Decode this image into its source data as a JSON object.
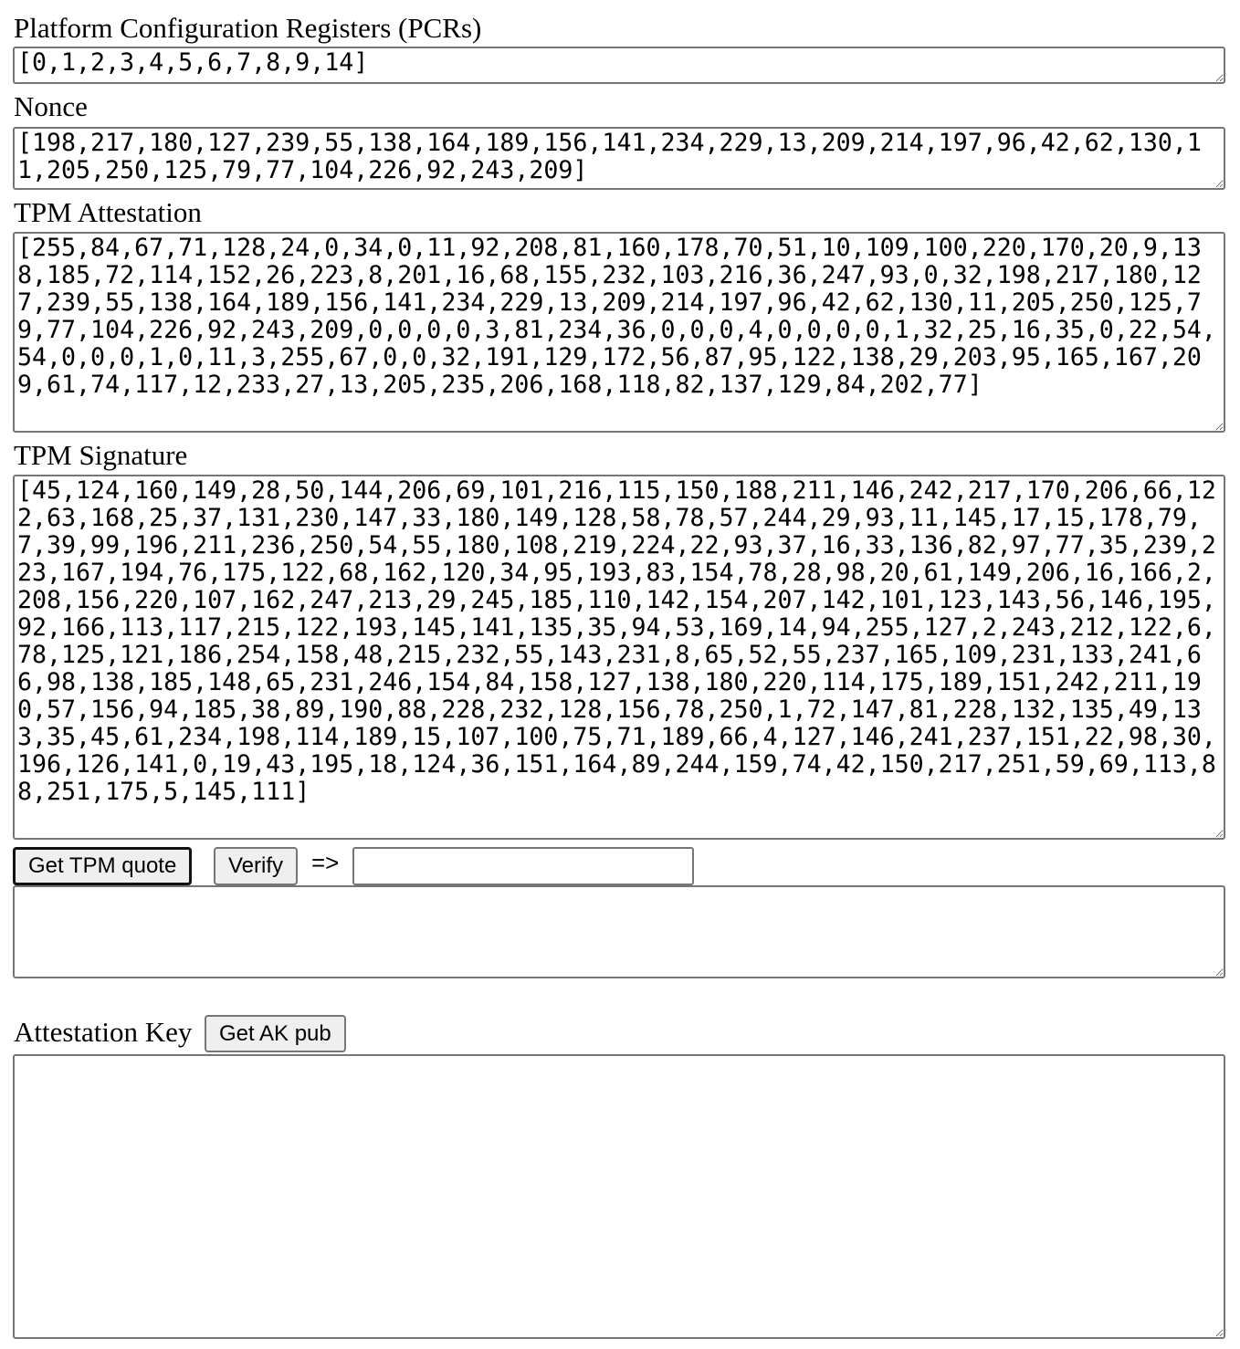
{
  "pcrs": {
    "label": "Platform Configuration Registers (PCRs)",
    "value": "[0,1,2,3,4,5,6,7,8,9,14]"
  },
  "nonce": {
    "label": "Nonce",
    "value": "[198,217,180,127,239,55,138,164,189,156,141,234,229,13,209,214,197,96,42,62,130,11,205,250,125,79,77,104,226,92,243,209]"
  },
  "attestation": {
    "label": "TPM Attestation",
    "value": "[255,84,67,71,128,24,0,34,0,11,92,208,81,160,178,70,51,10,109,100,220,170,20,9,138,185,72,114,152,26,223,8,201,16,68,155,232,103,216,36,247,93,0,32,198,217,180,127,239,55,138,164,189,156,141,234,229,13,209,214,197,96,42,62,130,11,205,250,125,79,77,104,226,92,243,209,0,0,0,0,3,81,234,36,0,0,0,4,0,0,0,0,1,32,25,16,35,0,22,54,54,0,0,0,1,0,11,3,255,67,0,0,32,191,129,172,56,87,95,122,138,29,203,95,165,167,209,61,74,117,12,233,27,13,205,235,206,168,118,82,137,129,84,202,77]"
  },
  "signature": {
    "label": "TPM Signature",
    "value": "[45,124,160,149,28,50,144,206,69,101,216,115,150,188,211,146,242,217,170,206,66,122,63,168,25,37,131,230,147,33,180,149,128,58,78,57,244,29,93,11,145,17,15,178,79,7,39,99,196,211,236,250,54,55,180,108,219,224,22,93,37,16,33,136,82,97,77,35,239,223,167,194,76,175,122,68,162,120,34,95,193,83,154,78,28,98,20,61,149,206,16,166,2,208,156,220,107,162,247,213,29,245,185,110,142,154,207,142,101,123,143,56,146,195,92,166,113,117,215,122,193,145,141,135,35,94,53,169,14,94,255,127,2,243,212,122,6,78,125,121,186,254,158,48,215,232,55,143,231,8,65,52,55,237,165,109,231,133,241,66,98,138,185,148,65,231,246,154,84,158,127,138,180,220,114,175,189,151,242,211,190,57,156,94,185,38,89,190,88,228,232,128,156,78,250,1,72,147,81,228,132,135,49,133,35,45,61,234,198,114,189,15,107,100,75,71,189,66,4,127,146,241,237,151,22,98,30,196,126,141,0,19,43,195,18,124,36,151,164,89,244,159,74,42,150,217,251,59,69,113,88,251,175,5,145,111]"
  },
  "actions": {
    "get_quote": "Get TPM quote",
    "verify": "Verify",
    "arrow": "=>",
    "verify_result": "",
    "output": ""
  },
  "ak": {
    "label": "Attestation Key",
    "button": "Get AK pub",
    "value": ""
  }
}
